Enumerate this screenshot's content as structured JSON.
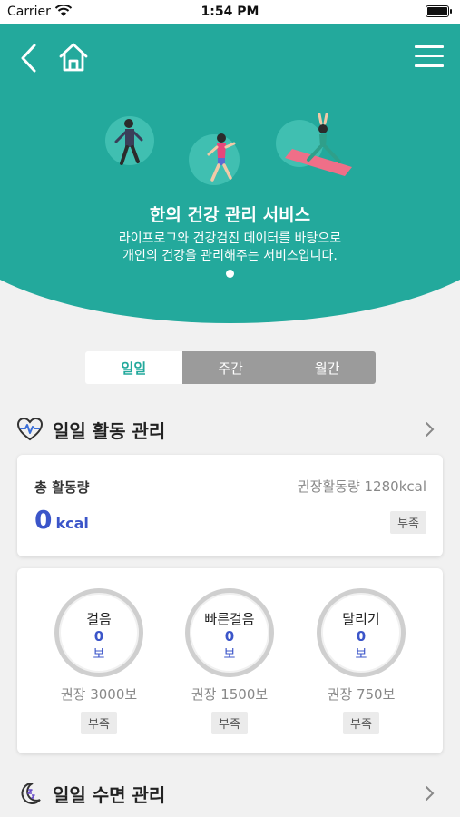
{
  "status_bar": {
    "carrier": "Carrier",
    "time": "1:54 PM"
  },
  "hero": {
    "title": "한의 건강 관리 서비스",
    "desc_line1": "라이프로그와 건강검진 데이터를 바탕으로",
    "desc_line2": "개인의 건강을 관리해주는 서비스입니다.",
    "bg_color": "#23a99c"
  },
  "period_tabs": [
    {
      "label": "일일",
      "active": true
    },
    {
      "label": "주간",
      "active": false
    },
    {
      "label": "월간",
      "active": false
    }
  ],
  "activity_section": {
    "title": "일일 활동 관리",
    "icon": "heart-pulse-icon",
    "total": {
      "label": "총 활동량",
      "recommended": "권장활동량 1280kcal",
      "value": "0",
      "unit": "kcal",
      "status": "부족"
    },
    "metrics": [
      {
        "name": "걸음",
        "value": "0",
        "unit": "보",
        "recommended": "권장 3000보",
        "status": "부족"
      },
      {
        "name": "빠른걸음",
        "value": "0",
        "unit": "보",
        "recommended": "권장 1500보",
        "status": "부족"
      },
      {
        "name": "달리기",
        "value": "0",
        "unit": "보",
        "recommended": "권장 750보",
        "status": "부족"
      }
    ]
  },
  "sleep_section": {
    "title": "일일 수면 관리",
    "icon": "moon-sleep-icon"
  }
}
